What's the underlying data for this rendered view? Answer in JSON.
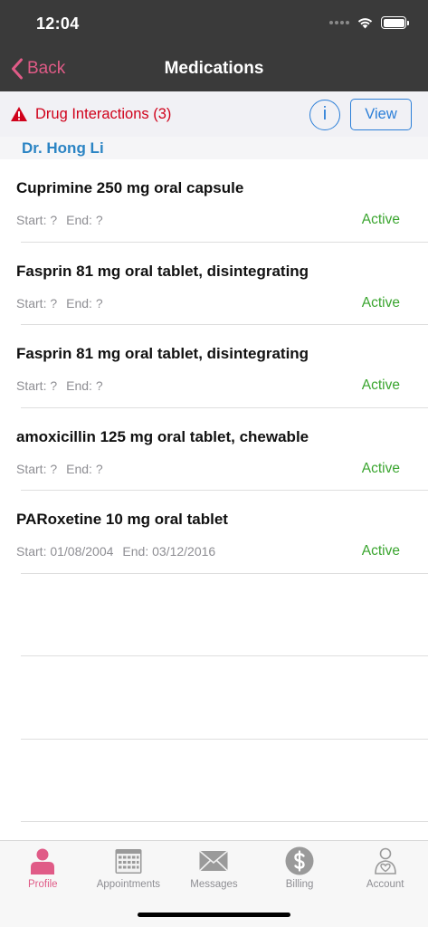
{
  "status_bar": {
    "time": "12:04"
  },
  "nav": {
    "back_label": "Back",
    "title": "Medications"
  },
  "interactions": {
    "label": "Drug Interactions (3)",
    "info_label": "i",
    "view_label": "View"
  },
  "doctor": {
    "name": "Dr. Hong Li"
  },
  "medications": [
    {
      "name": "Cuprimine 250 mg oral capsule",
      "start": "Start: ?",
      "end": "End: ?",
      "status": "Active"
    },
    {
      "name": "Fasprin 81 mg oral tablet, disintegrating",
      "start": "Start: ?",
      "end": "End: ?",
      "status": "Active"
    },
    {
      "name": "Fasprin 81 mg oral tablet, disintegrating",
      "start": "Start: ?",
      "end": "End: ?",
      "status": "Active"
    },
    {
      "name": "amoxicillin 125 mg oral tablet, chewable",
      "start": "Start: ?",
      "end": "End: ?",
      "status": "Active"
    },
    {
      "name": "PARoxetine 10 mg oral tablet",
      "start": "Start: 01/08/2004",
      "end": "End: 03/12/2016",
      "status": "Active"
    }
  ],
  "tabs": [
    {
      "label": "Profile",
      "icon": "profile-icon",
      "active": true
    },
    {
      "label": "Appointments",
      "icon": "calendar-icon",
      "active": false
    },
    {
      "label": "Messages",
      "icon": "envelope-icon",
      "active": false
    },
    {
      "label": "Billing",
      "icon": "dollar-icon",
      "active": false
    },
    {
      "label": "Account",
      "icon": "account-icon",
      "active": false
    }
  ],
  "colors": {
    "accent_pink": "#e05b87",
    "link_blue": "#2c7fd8",
    "alert_red": "#d0021b",
    "active_green": "#3aa52f",
    "header_dark": "#3a3a3a"
  }
}
